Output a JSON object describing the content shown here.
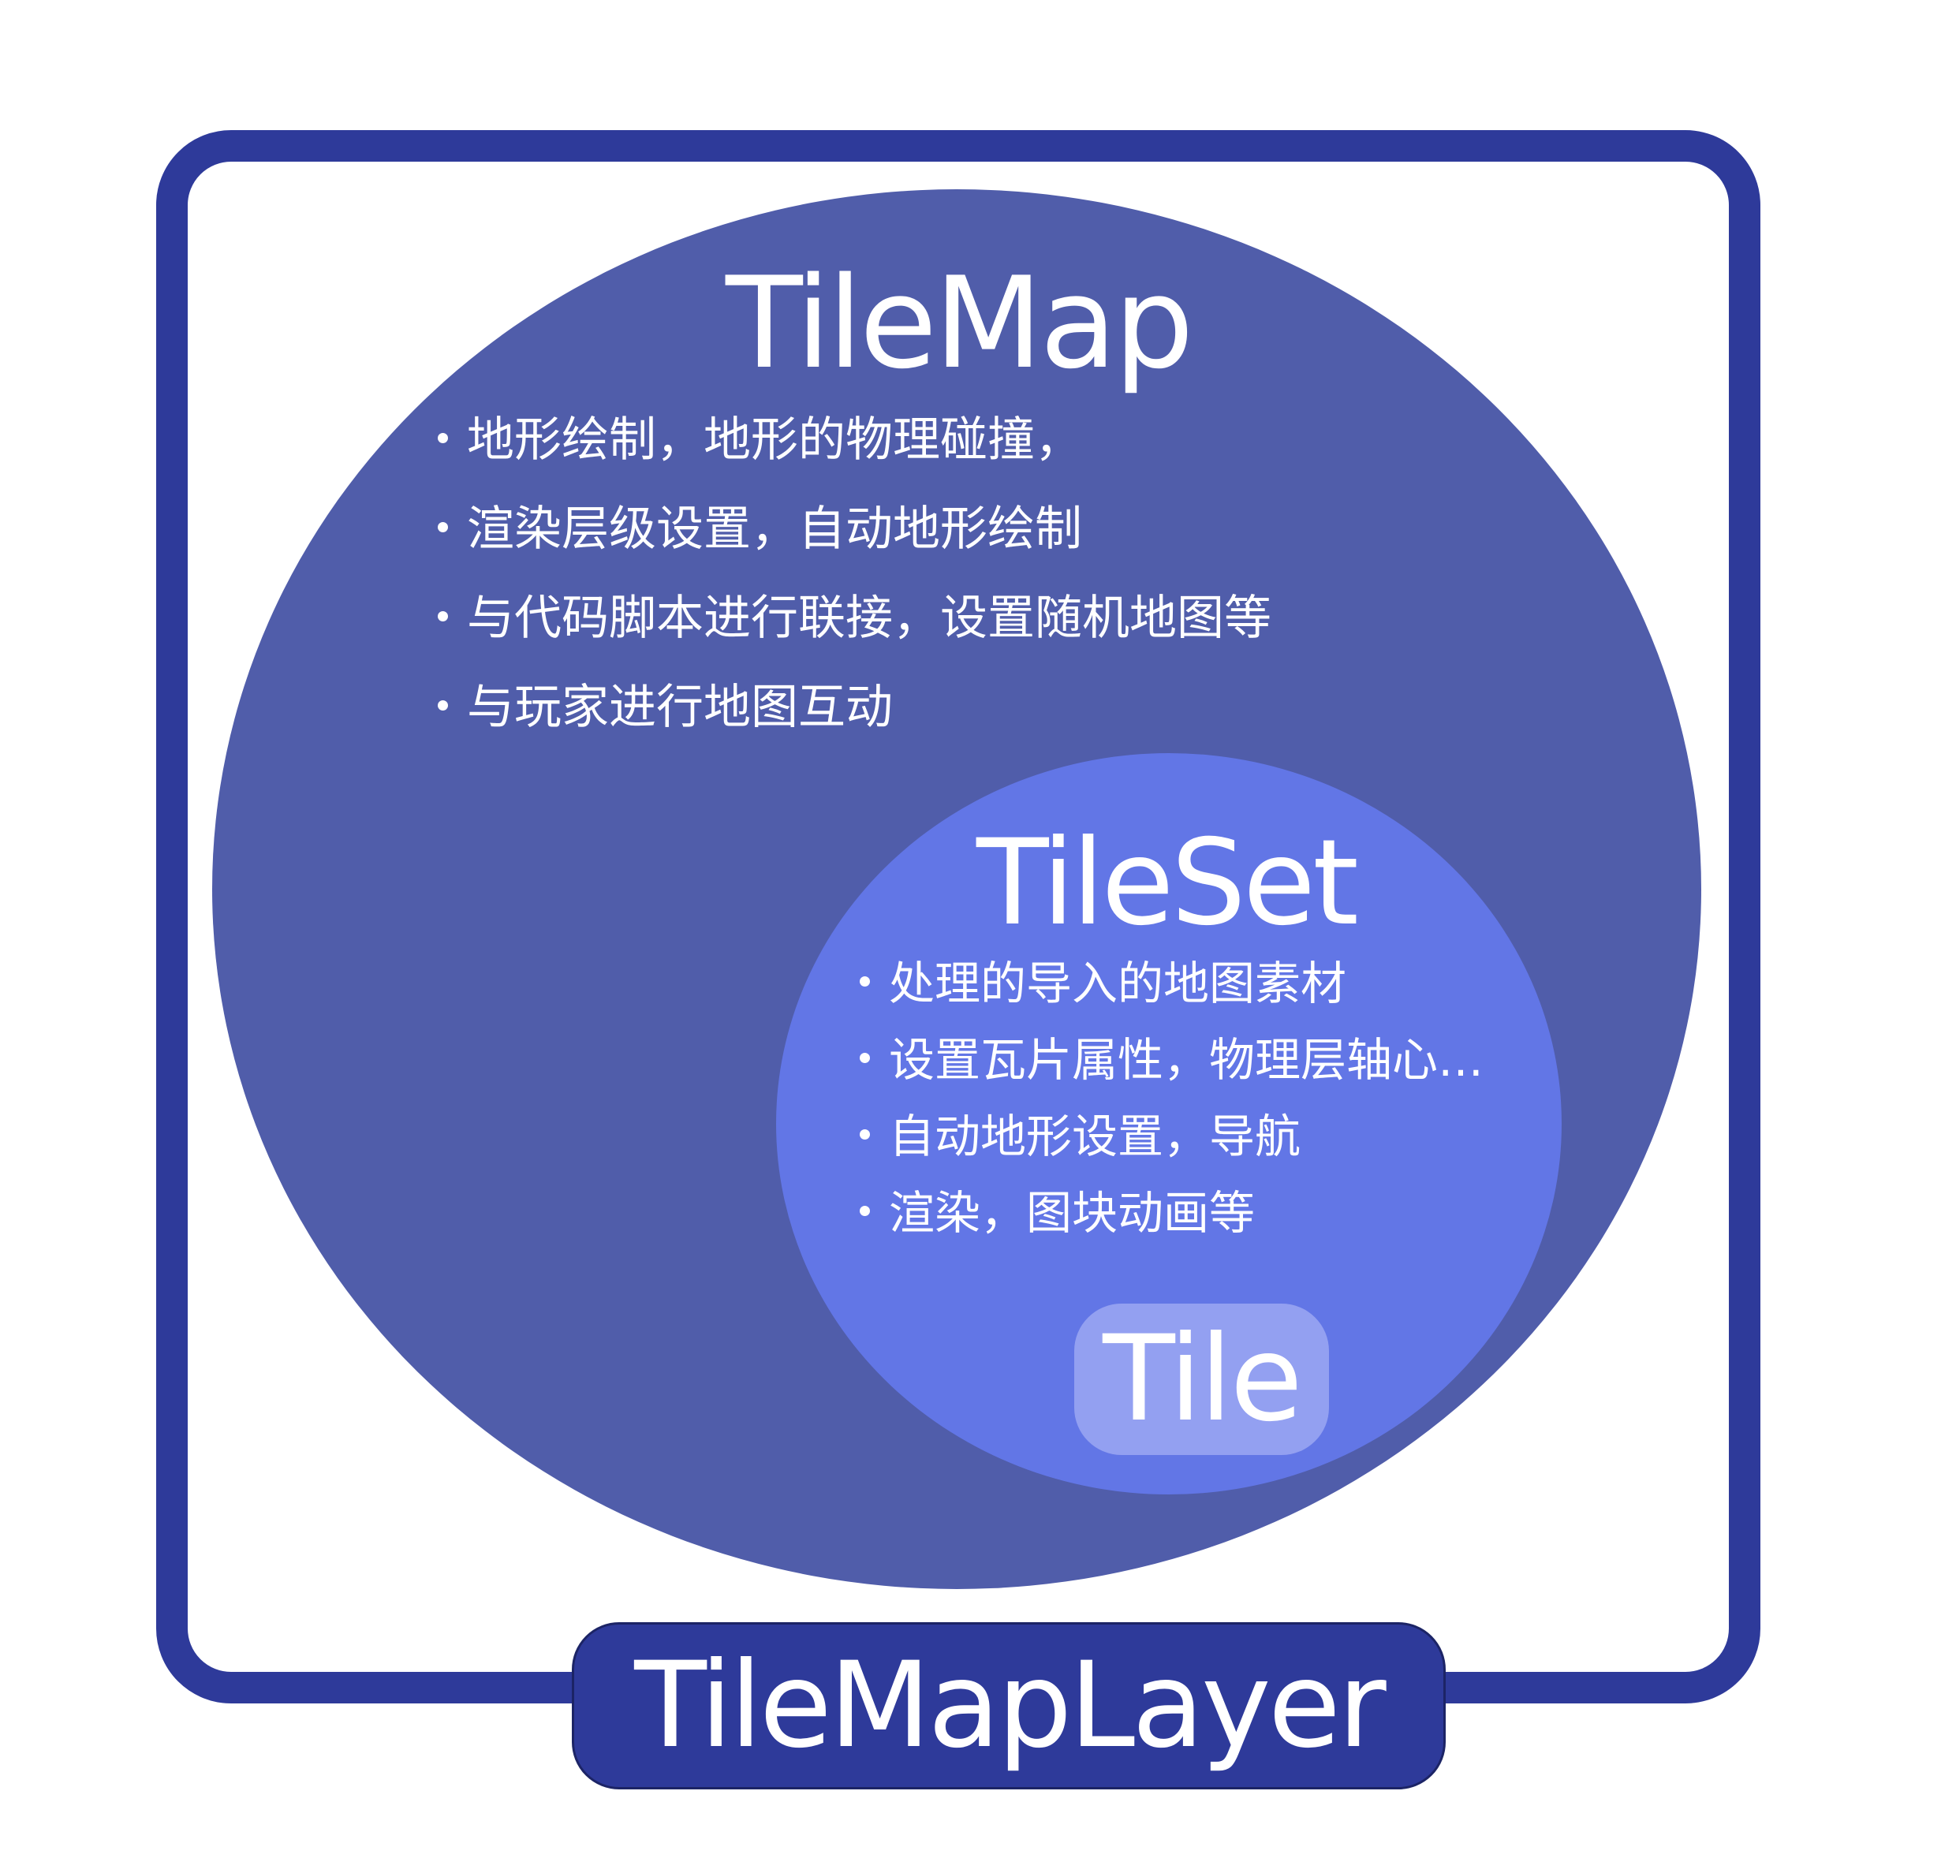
{
  "colors": {
    "frame": "#2e3a9a",
    "tilemap_circle": "#505daa",
    "tileset_circle": "#6276e6",
    "tile_box": "#93a0f1",
    "layer_label_box": "#2e3a9a",
    "text": "#ffffff",
    "background": "#ffffff"
  },
  "tilemap": {
    "title": "TileMap",
    "bullets": [
      "地形绘制，地形的物理碰撞，",
      "渲染层级设置，自动地形绘制",
      "与代码脚本进行联接，设置随机地图等",
      "与玩家进行地图互动"
    ]
  },
  "tileset": {
    "title": "TileSet",
    "bullets": [
      "处理的导入的地图素材",
      "设置瓦片属性，物理层轴心…",
      "自动地形设置，导航",
      "渲染，图块动画等"
    ]
  },
  "tile": {
    "title": "Tile"
  },
  "layer": {
    "title": "TileMapLayer"
  }
}
